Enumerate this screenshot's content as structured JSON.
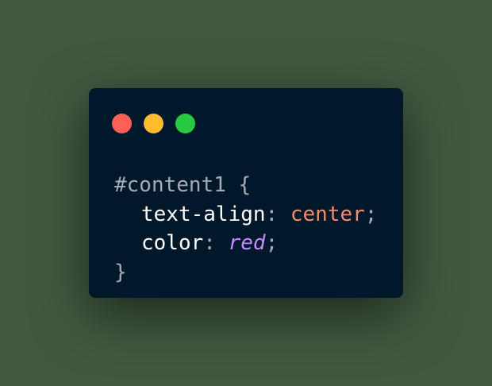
{
  "colors": {
    "background": "#405940",
    "window": "#01172a",
    "dot_close": "#fe5f57",
    "dot_minimize": "#febc2e",
    "dot_maximize": "#28c840",
    "selector": "#a5acb7",
    "property": "#ffffff",
    "value_keyword": "#f08d6f",
    "value_color_keyword": "#c38cff"
  },
  "icons": {
    "close": "red-circle-window-control",
    "minimize": "yellow-circle-window-control",
    "maximize": "green-circle-window-control"
  },
  "code": {
    "selector": "#content1",
    "open_brace": "{",
    "close_brace": "}",
    "declarations": [
      {
        "property": "text-align",
        "colon": ":",
        "value": "center",
        "semicolon": ";"
      },
      {
        "property": "color",
        "colon": ":",
        "value": "red",
        "semicolon": ";"
      }
    ]
  }
}
